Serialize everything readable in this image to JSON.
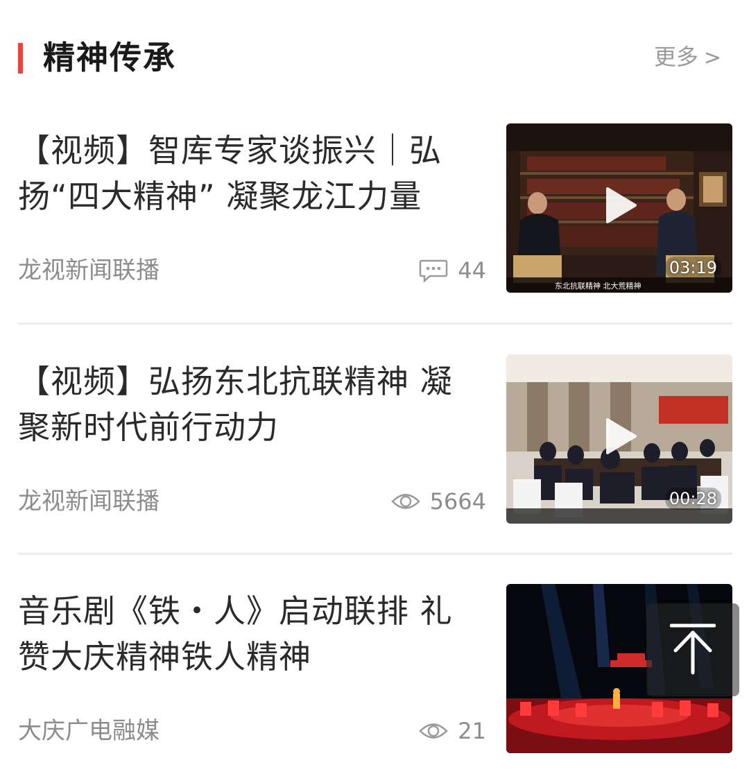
{
  "section": {
    "title": "精神传承",
    "more_label": "更多",
    "more_chevron": ">",
    "accent_color": "#e8453c"
  },
  "items": [
    {
      "title": "【视频】智库专家谈振兴｜弘扬“四大精神” 凝聚龙江力量",
      "source": "龙视新闻联播",
      "stat_icon": "comment-icon",
      "stat_value": "44",
      "is_video": true,
      "duration": "03:19",
      "thumb_caption": "东北抗联精神  北大荒精神"
    },
    {
      "title": "【视频】弘扬东北抗联精神 凝聚新时代前行动力",
      "source": "龙视新闻联播",
      "stat_icon": "eye-icon",
      "stat_value": "5664",
      "is_video": true,
      "duration": "00:28"
    },
    {
      "title": "音乐剧《铁・人》启动联排 礼赞大庆精神铁人精神",
      "source": "大庆广电融媒",
      "stat_icon": "eye-icon",
      "stat_value": "21",
      "is_video": false
    }
  ],
  "back_to_top_icon": "arrow-up-to-top-icon"
}
